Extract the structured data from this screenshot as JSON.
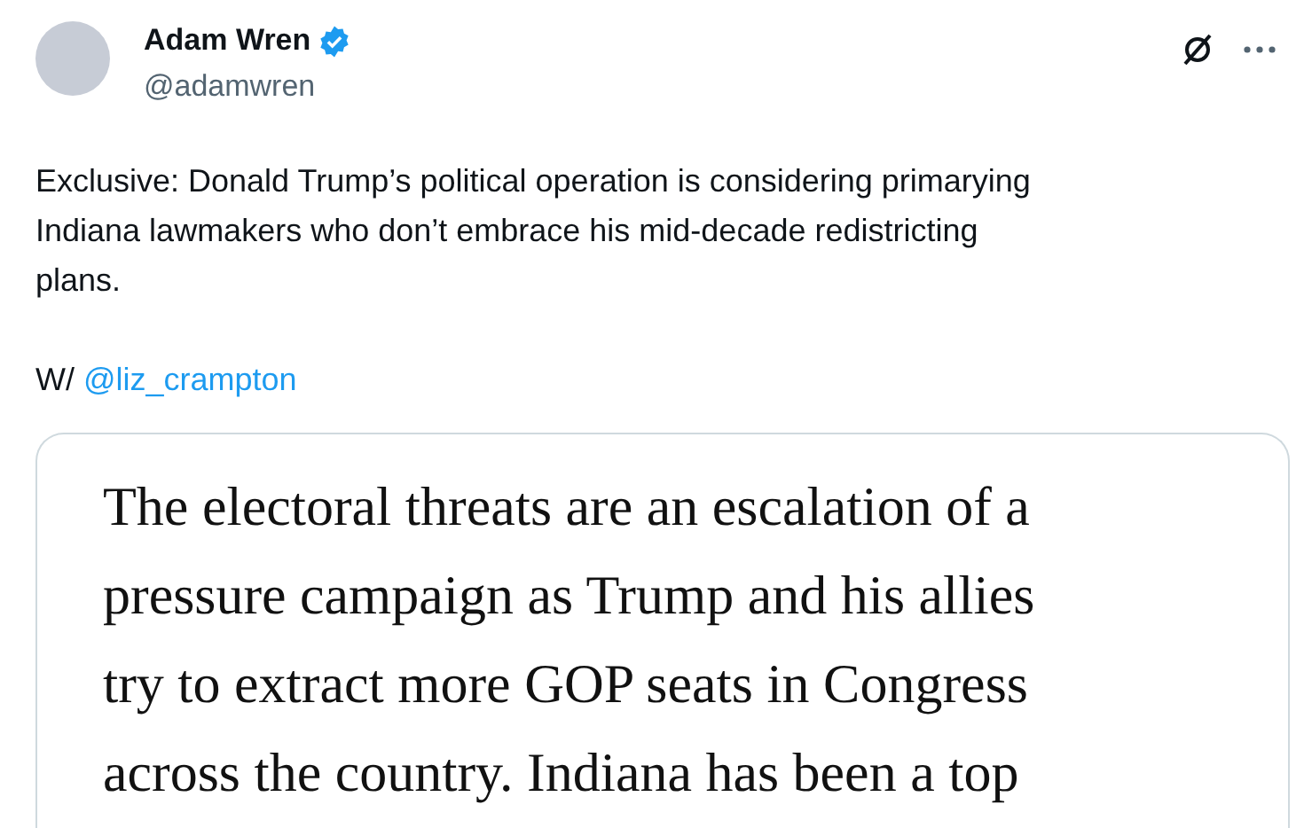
{
  "author": {
    "name": "Adam Wren",
    "verified": true,
    "handle": "@adamwren"
  },
  "tweet": {
    "text": "Exclusive: Donald Trump’s political operation is considering primarying\nIndiana lawmakers who don’t embrace his mid-decade redistricting\nplans.",
    "credit": "W/",
    "mention": "@liz_crampton"
  },
  "image_card": {
    "lines": [
      "The electoral threats are an escalation of a",
      "pressure campaign as Trump and his allies",
      "try to extract more GOP seats in Congress",
      "across the country. Indiana has been a top"
    ]
  }
}
